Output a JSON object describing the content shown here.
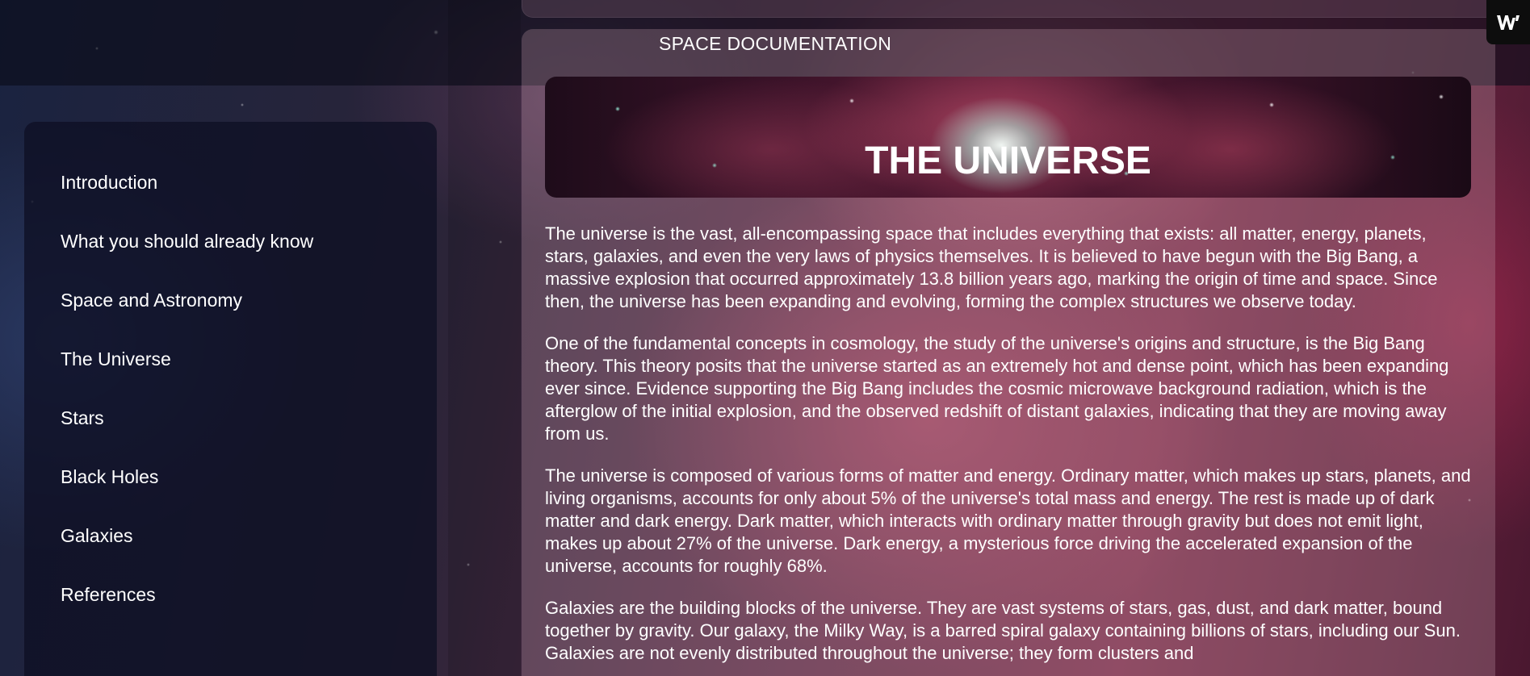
{
  "nav": {
    "items": [
      {
        "label": "Introduction"
      },
      {
        "label": "What you should already know"
      },
      {
        "label": "Space and Astronomy"
      },
      {
        "label": "The Universe"
      },
      {
        "label": "Stars"
      },
      {
        "label": "Black Holes"
      },
      {
        "label": "Galaxies"
      },
      {
        "label": "References"
      }
    ]
  },
  "main": {
    "title": "SPACE DOCUMENTATION",
    "section": {
      "heading": "THE UNIVERSE",
      "paragraphs": [
        "The universe is the vast, all-encompassing space that includes everything that exists: all matter, energy, planets, stars, galaxies, and even the very laws of physics themselves. It is believed to have begun with the Big Bang, a massive explosion that occurred approximately 13.8 billion years ago, marking the origin of time and space. Since then, the universe has been expanding and evolving, forming the complex structures we observe today.",
        "One of the fundamental concepts in cosmology, the study of the universe's origins and structure, is the Big Bang theory. This theory posits that the universe started as an extremely hot and dense point, which has been expanding ever since. Evidence supporting the Big Bang includes the cosmic microwave background radiation, which is the afterglow of the initial explosion, and the observed redshift of distant galaxies, indicating that they are moving away from us.",
        "The universe is composed of various forms of matter and energy. Ordinary matter, which makes up stars, planets, and living organisms, accounts for only about 5% of the universe's total mass and energy. The rest is made up of dark matter and dark energy. Dark matter, which interacts with ordinary matter through gravity but does not emit light, makes up about 27% of the universe. Dark energy, a mysterious force driving the accelerated expansion of the universe, accounts for roughly 68%.",
        "Galaxies are the building blocks of the universe. They are vast systems of stars, gas, dust, and dark matter, bound together by gravity. Our galaxy, the Milky Way, is a barred spiral galaxy containing billions of stars, including our Sun. Galaxies are not evenly distributed throughout the universe; they form clusters and"
      ]
    }
  },
  "corner_logo": {
    "icon": "w-logo-icon"
  },
  "colors": {
    "text": "#ffffff",
    "topbar": "#0a0c18",
    "sidebar": "#0e1024",
    "corner_logo_bg": "#0d0d0d"
  }
}
